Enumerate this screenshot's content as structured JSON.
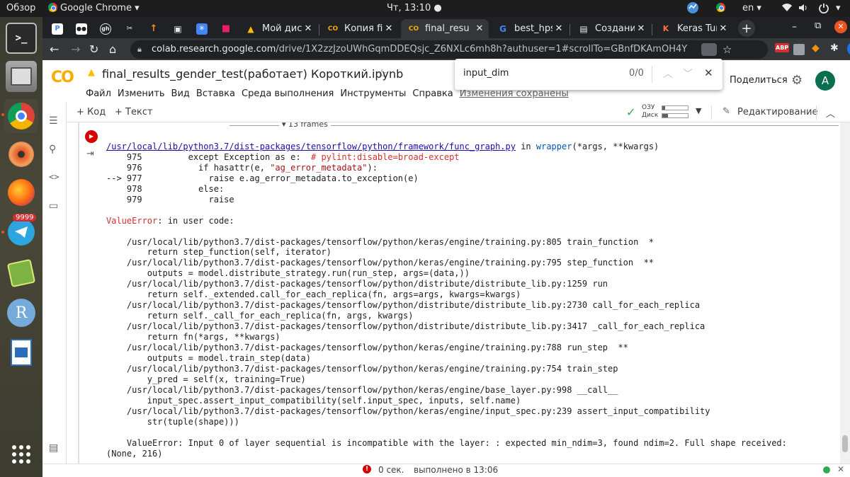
{
  "system": {
    "overview": "Обзор",
    "app_name": "Google Chrome",
    "clock": "Чт, 13:10",
    "lang": "en"
  },
  "dock": {
    "telegram_badge": "9999",
    "r_label": "R"
  },
  "tabs": [
    {
      "title": "",
      "favicon": "P",
      "color": "#4285f4"
    },
    {
      "title": "",
      "favicon": "●●",
      "color": "#202124"
    },
    {
      "title": "",
      "favicon": "gh",
      "color": "#e8eaed"
    },
    {
      "title": "",
      "favicon": "✂",
      "color": "#e8eaed"
    },
    {
      "title": "",
      "favicon": "↑",
      "color": "#f29111"
    },
    {
      "title": "",
      "favicon": "▣",
      "color": "#e8eaed"
    },
    {
      "title": "",
      "favicon": "✳",
      "color": "#4285f4"
    },
    {
      "title": "",
      "favicon": "■",
      "color": "#e91e63"
    },
    {
      "title": "Мой диск",
      "favicon": "▲"
    },
    {
      "title": "Копия fina",
      "favicon": "CO"
    },
    {
      "title": "final_resu",
      "favicon": "CO"
    },
    {
      "title": "best_hps",
      "favicon": "G"
    },
    {
      "title": "Создание",
      "favicon": "▤"
    },
    {
      "title": "Keras Tun",
      "favicon": "K"
    }
  ],
  "url": {
    "host": "colab.research.google.com",
    "path": "/drive/1X2zzJzoUWhGqmDDEQsjc_Z6NXLc6mh8h?authuser=1#scrollTo=GBnfDKAmOH4Y"
  },
  "extensions": [
    "ABP",
    "●",
    "◆",
    "✱",
    "A"
  ],
  "colab": {
    "logo": "CO",
    "notebook_title": "final_results_gender_test(работает) Короткий.ipynb",
    "menu": [
      "Файл",
      "Изменить",
      "Вид",
      "Вставка",
      "Среда выполнения",
      "Инструменты",
      "Справка"
    ],
    "save_status": "Изменения сохранены",
    "share_label": "Поделиться",
    "avatar": "A"
  },
  "find": {
    "query": "input_dim",
    "count": "0/0"
  },
  "nb_toolbar": {
    "add_code": "+ Код",
    "add_text": "+ Текст",
    "ram_label": "ОЗУ",
    "disk_label": "Диск",
    "editing": "Редактирование"
  },
  "output": {
    "frames_label": "13 frames",
    "link_path": "/usr/local/lib/python3.7/dist-packages/tensorflow/python/framework/func_graph.py",
    "in_text": " in ",
    "func_name": "wrapper",
    "func_args": "(*args, **kwargs)",
    "l975_num": "    975",
    "l975_code": "         except Exception as e:  ",
    "l975_comment": "# pylint:disable=broad-except",
    "l976_num": "    976",
    "l976_code_a": "           if hasattr(e, ",
    "l976_str": "\"ag_error_metadata\"",
    "l976_code_b": "):",
    "l977": "--> 977             raise e.ag_error_metadata.to_exception(e)",
    "l978": "    978           else:",
    "l979": "    979             raise",
    "value_error_name": "ValueError",
    "value_error_tail": ": in user code:",
    "trace": [
      "    /usr/local/lib/python3.7/dist-packages/tensorflow/python/keras/engine/training.py:805 train_function  *",
      "        return step_function(self, iterator)",
      "    /usr/local/lib/python3.7/dist-packages/tensorflow/python/keras/engine/training.py:795 step_function  **",
      "        outputs = model.distribute_strategy.run(run_step, args=(data,))",
      "    /usr/local/lib/python3.7/dist-packages/tensorflow/python/distribute/distribute_lib.py:1259 run",
      "        return self._extended.call_for_each_replica(fn, args=args, kwargs=kwargs)",
      "    /usr/local/lib/python3.7/dist-packages/tensorflow/python/distribute/distribute_lib.py:2730 call_for_each_replica",
      "        return self._call_for_each_replica(fn, args, kwargs)",
      "    /usr/local/lib/python3.7/dist-packages/tensorflow/python/distribute/distribute_lib.py:3417 _call_for_each_replica",
      "        return fn(*args, **kwargs)",
      "    /usr/local/lib/python3.7/dist-packages/tensorflow/python/keras/engine/training.py:788 run_step  **",
      "        outputs = model.train_step(data)",
      "    /usr/local/lib/python3.7/dist-packages/tensorflow/python/keras/engine/training.py:754 train_step",
      "        y_pred = self(x, training=True)",
      "    /usr/local/lib/python3.7/dist-packages/tensorflow/python/keras/engine/base_layer.py:998 __call__",
      "        input_spec.assert_input_compatibility(self.input_spec, inputs, self.name)",
      "    /usr/local/lib/python3.7/dist-packages/tensorflow/python/keras/engine/input_spec.py:239 assert_input_compatibility",
      "        str(tuple(shape)))"
    ],
    "final_error_1": "    ValueError: Input 0 of layer sequential is incompatible with the layer: : expected min_ndim=3, found ndim=2. Full shape received:",
    "final_error_2": "(None, 216)"
  },
  "status": {
    "elapsed": "0 сек.",
    "completed": "выполнено в 13:06"
  }
}
